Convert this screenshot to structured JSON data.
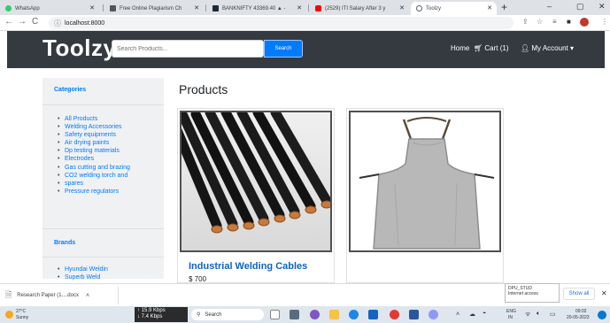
{
  "browser": {
    "tabs": [
      {
        "title": "WhatsApp",
        "color": "#25d366"
      },
      {
        "title": "Free Online Plagiarism Ch",
        "color": "#555555"
      },
      {
        "title": "BANKNIFTY 43369.40 ▲ -",
        "color": "#1e2a3a"
      },
      {
        "title": "(2529) ITI Salary After 3 y",
        "color": "#ff0000"
      },
      {
        "title": "Toolzy",
        "color": "#5f6368"
      }
    ],
    "new_tab": "+",
    "url": "localhost:8000"
  },
  "navbar": {
    "brand": "Toolzy",
    "search_placeholder": "Search Products...",
    "search_button": "Search",
    "home": "Home",
    "cart": "Cart (1)",
    "account": "My Account"
  },
  "sidebar": {
    "categories_heading": "Categories",
    "categories": [
      "All Products",
      "Welding Accessories",
      "Safety equipments",
      "Air drying paints",
      "Dp testing materials",
      "Electrodes",
      "Gas cutting and brazing",
      "CO2 welding torch and",
      "spares",
      "Pressure regulators"
    ],
    "brands_heading": "Brands",
    "brands": [
      "Hyundai Weldin",
      "Superb Weld"
    ]
  },
  "main": {
    "title": "Products",
    "products": [
      {
        "name": "Industrial Welding Cables",
        "price": "$ 700"
      },
      {
        "name": "",
        "price": ""
      }
    ]
  },
  "downloads": {
    "item": "Research Paper (1....docx",
    "tooltip_line1": "DPU_STUD",
    "tooltip_line2": "Internet access",
    "show_all": "Show all"
  },
  "taskbar": {
    "temp": "27°C",
    "weather": "Sunny",
    "net_up": "↑ 15.9 Kbps",
    "net_down": "↓ 7.4 Kbps",
    "search": "Search",
    "lang": "ENG",
    "lang2": "IN",
    "time": "09:02",
    "date": "20-05-2023"
  }
}
